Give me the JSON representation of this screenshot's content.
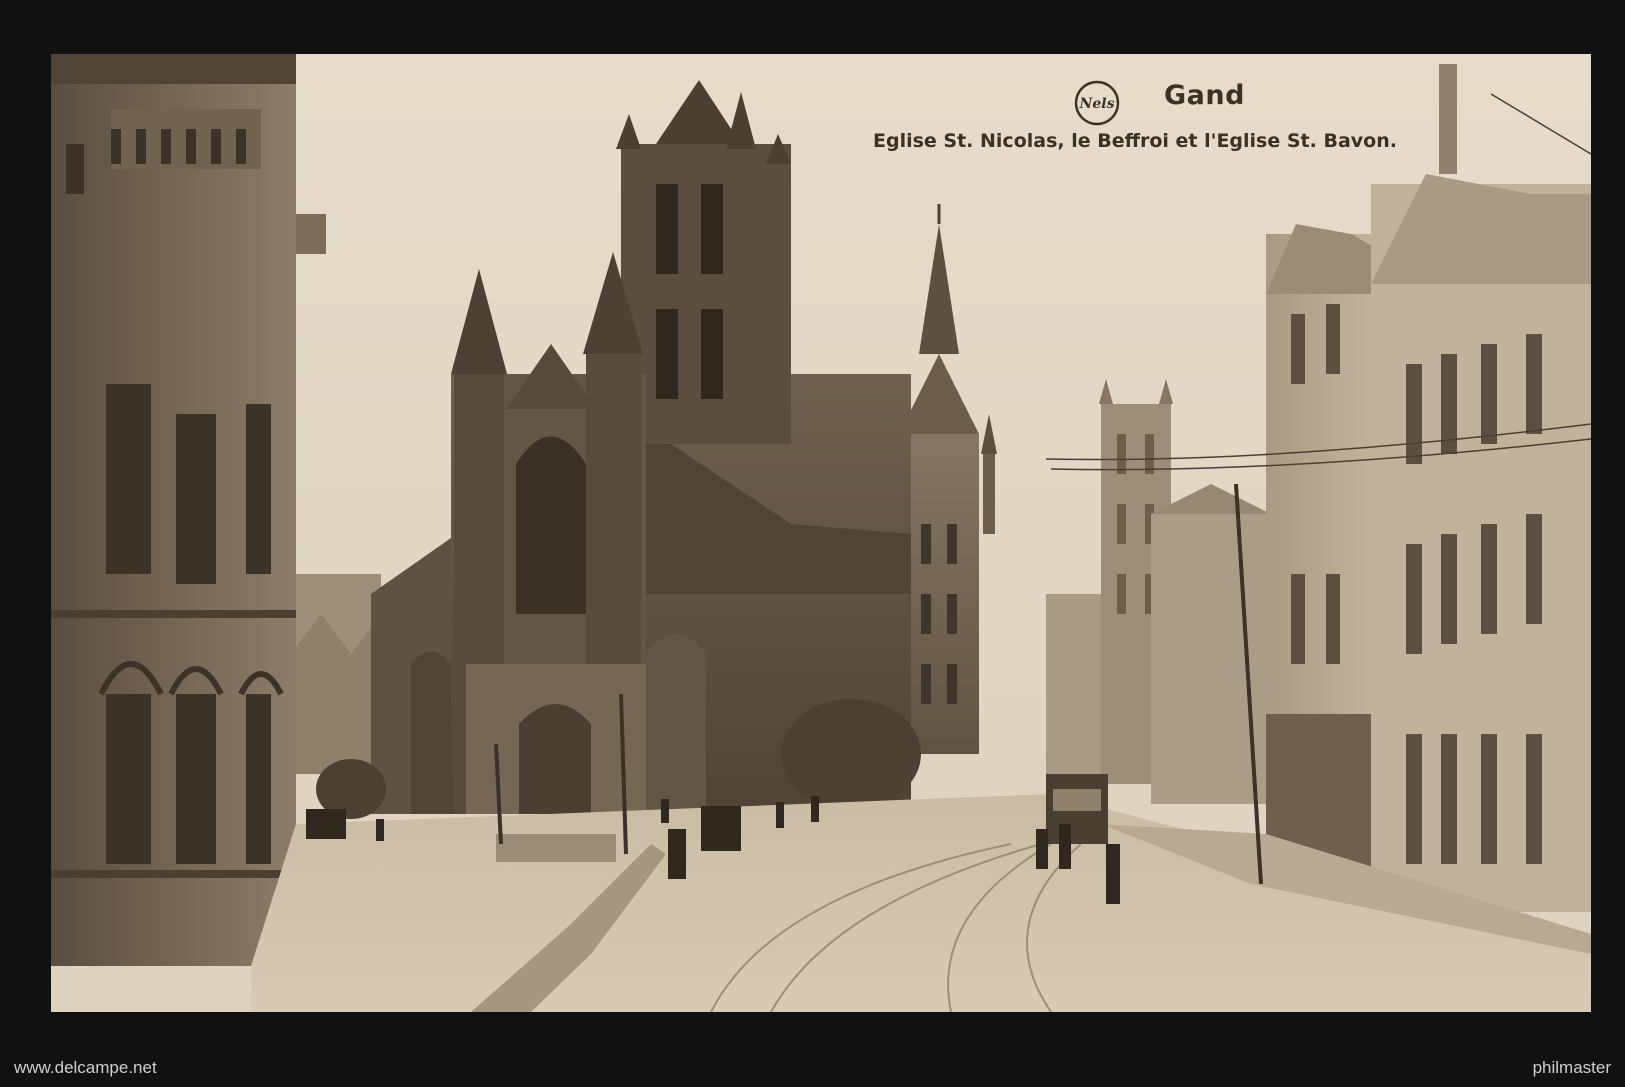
{
  "caption": {
    "place": "Gand",
    "title": "Eglise St. Nicolas, le Beffroi et l'Eglise St. Bavon.",
    "publisher_logo_text": "Nels"
  },
  "footer": {
    "left": "www.delcampe.net",
    "right": "philmaster"
  },
  "colors": {
    "sepia_paper": "#d9cdb8",
    "sepia_dark": "#3b3226",
    "frame": "#111111"
  }
}
